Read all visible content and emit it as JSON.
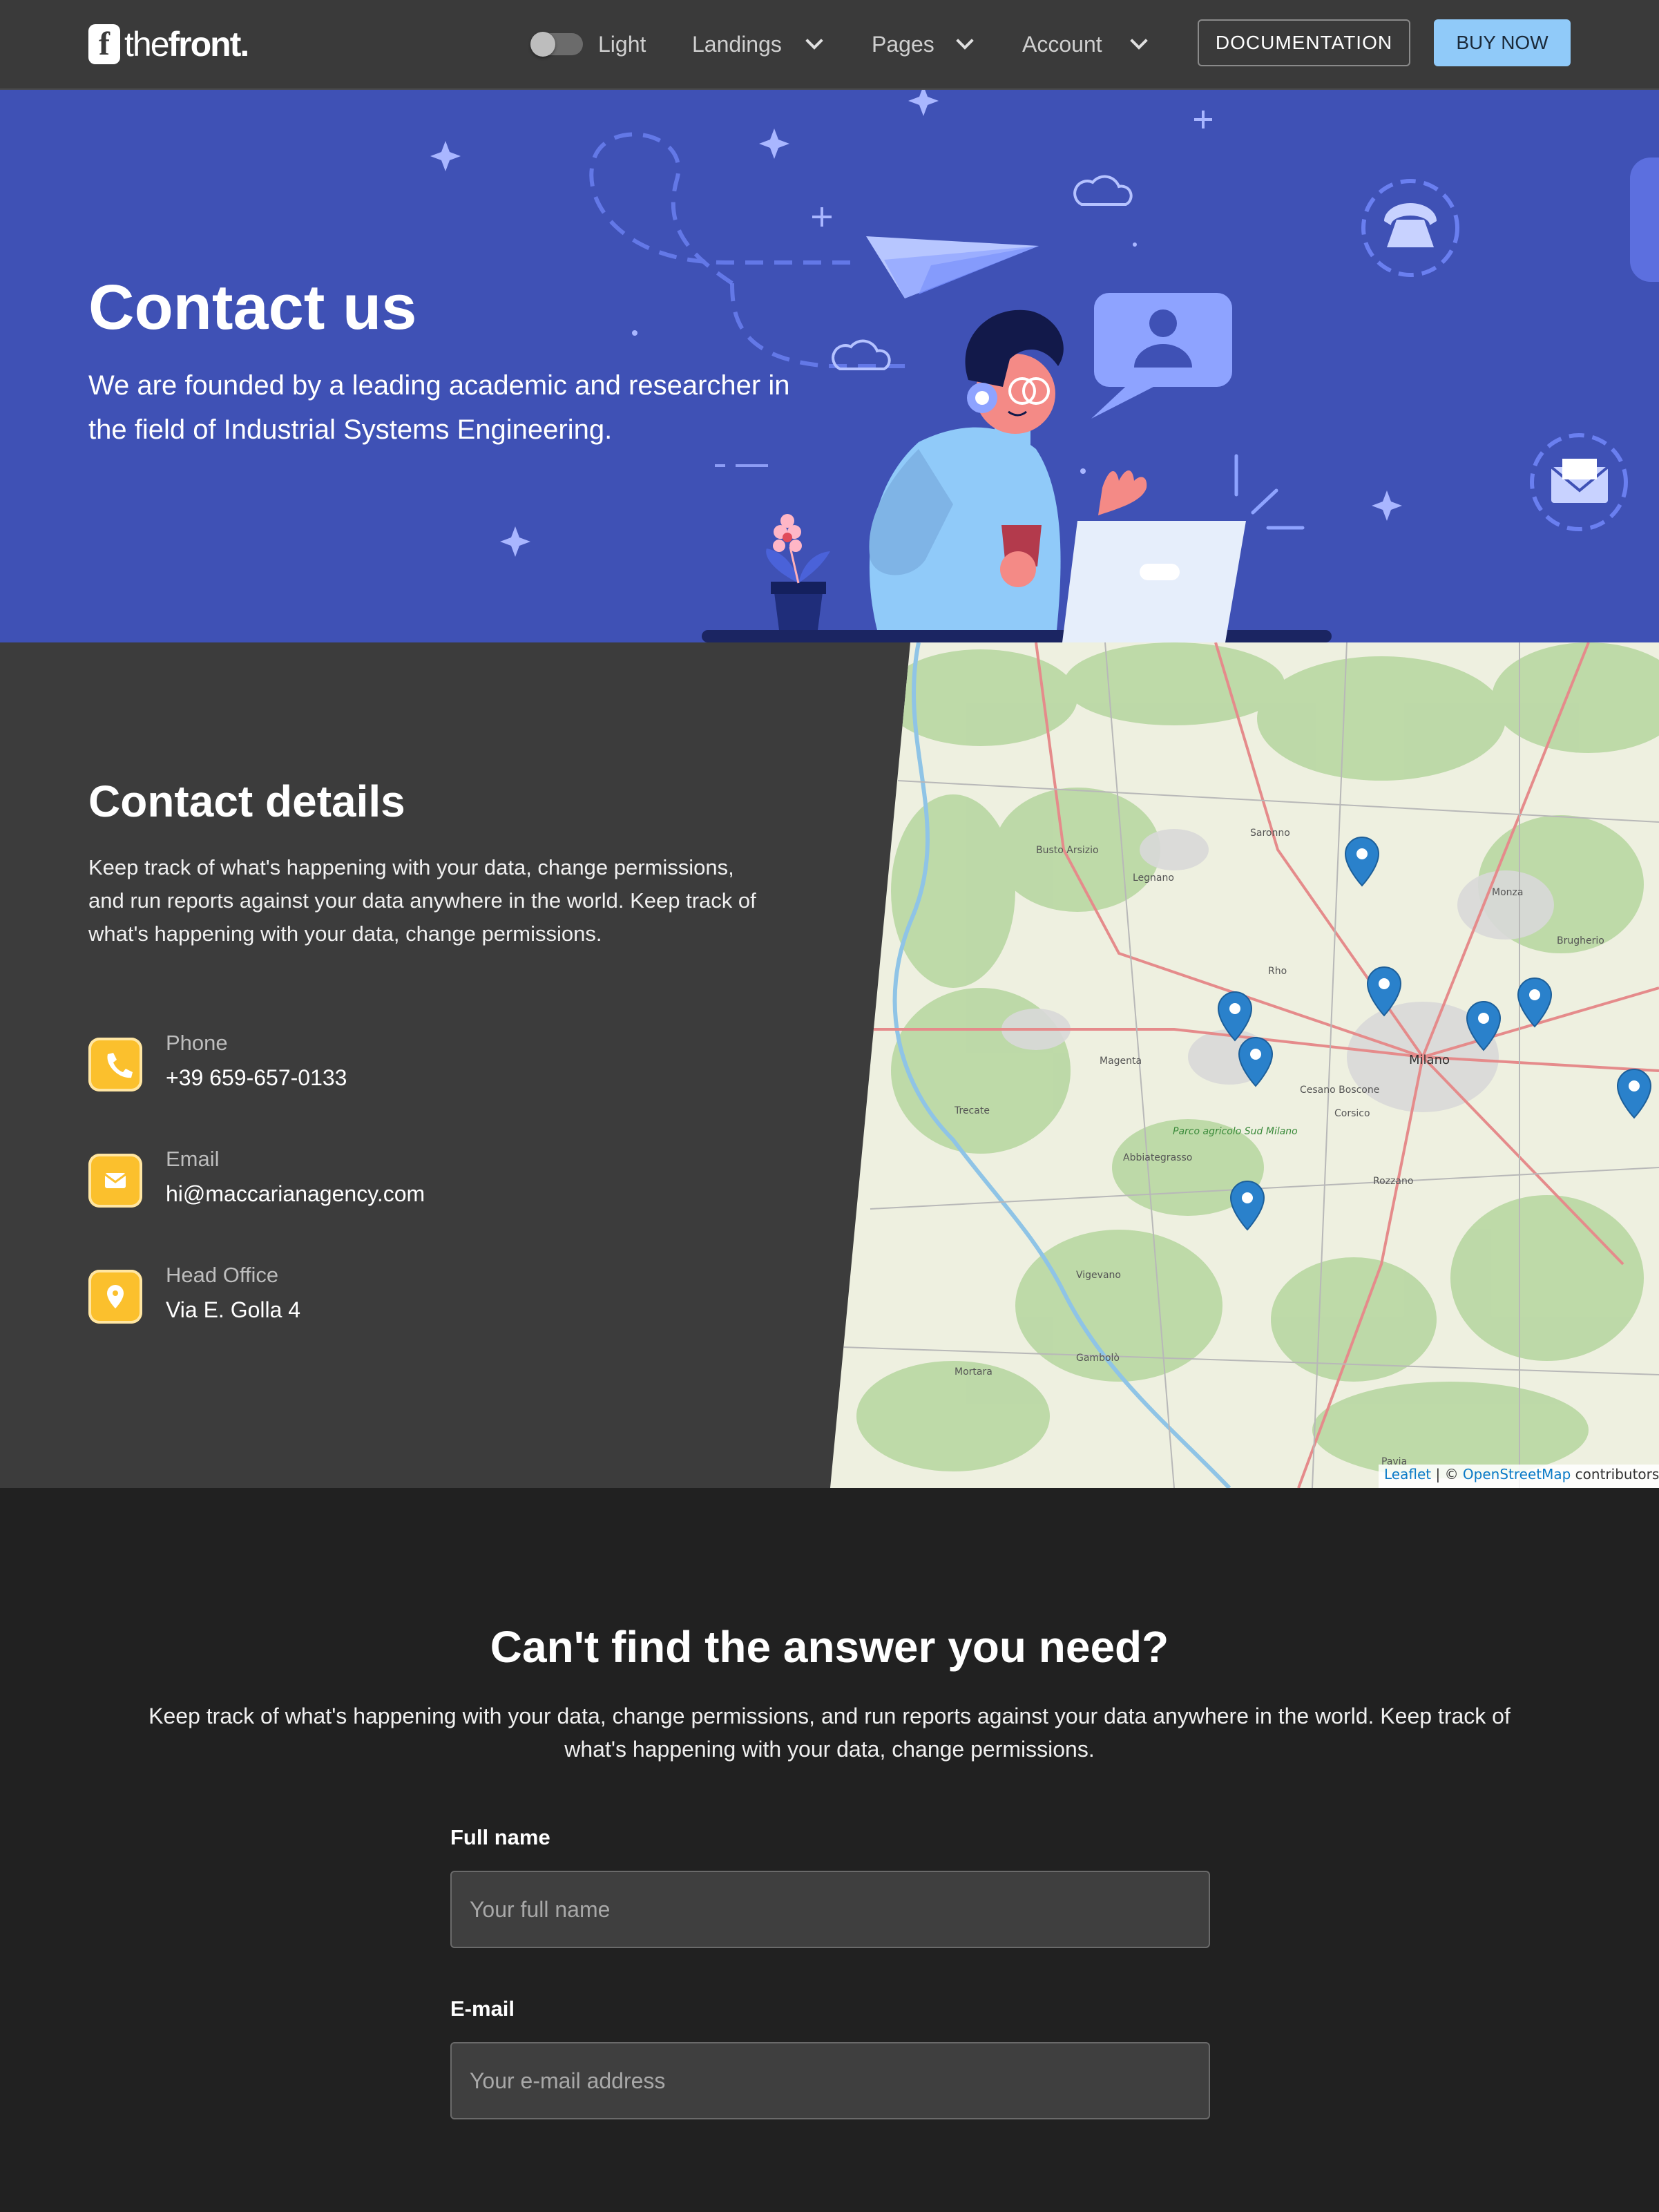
{
  "nav": {
    "logo_mark": "f",
    "logo_text_light": "the",
    "logo_text_bold": "front.",
    "theme_label": "Light",
    "menu": [
      {
        "label": "Landings"
      },
      {
        "label": "Pages"
      },
      {
        "label": "Account"
      }
    ],
    "documentation_label": "DOCUMENTATION",
    "buy_label": "BUY NOW"
  },
  "hero": {
    "title": "Contact us",
    "subtitle": "We are founded by a leading academic and researcher in the field of Industrial Systems Engineering."
  },
  "contact": {
    "title": "Contact details",
    "description": "Keep track of what's happening with your data, change permissions, and run reports against your data anywhere in the world. Keep track of what's happening with your data, change permissions.",
    "items": [
      {
        "icon": "phone-icon",
        "label": "Phone",
        "value": "+39 659-657-0133"
      },
      {
        "icon": "email-icon",
        "label": "Email",
        "value": "hi@maccarianagency.com"
      },
      {
        "icon": "location-icon",
        "label": "Head Office",
        "value": "Via E. Golla 4"
      }
    ]
  },
  "map": {
    "attribution_leaflet": "Leaflet",
    "attribution_sep": " | © ",
    "attribution_osm": "OpenStreetMap",
    "attribution_tail": " contributors",
    "city_label": "Milano",
    "labels": [
      "Busto Arsizio",
      "Legnano",
      "Saronno",
      "Monza",
      "Rho",
      "Magenta",
      "Abbiategrasso",
      "Vigevano",
      "Pavia",
      "Mortara",
      "Parco agricolo Sud Milano",
      "Brugherio",
      "Cesano Boscone",
      "Corsico",
      "Rozzano",
      "Trecate",
      "Gambolò"
    ]
  },
  "form": {
    "title": "Can't find the answer you need?",
    "description": "Keep track of what's happening with your data, change permissions, and run reports against your data anywhere in the world. Keep track of what's happening with your data, change permissions.",
    "full_name_label": "Full name",
    "full_name_placeholder": "Your full name",
    "email_label": "E-mail",
    "email_placeholder": "Your e-mail address"
  },
  "colors": {
    "hero_bg": "#3f51b5",
    "accent": "#90caf9",
    "icon_bg": "#fbc02d"
  }
}
